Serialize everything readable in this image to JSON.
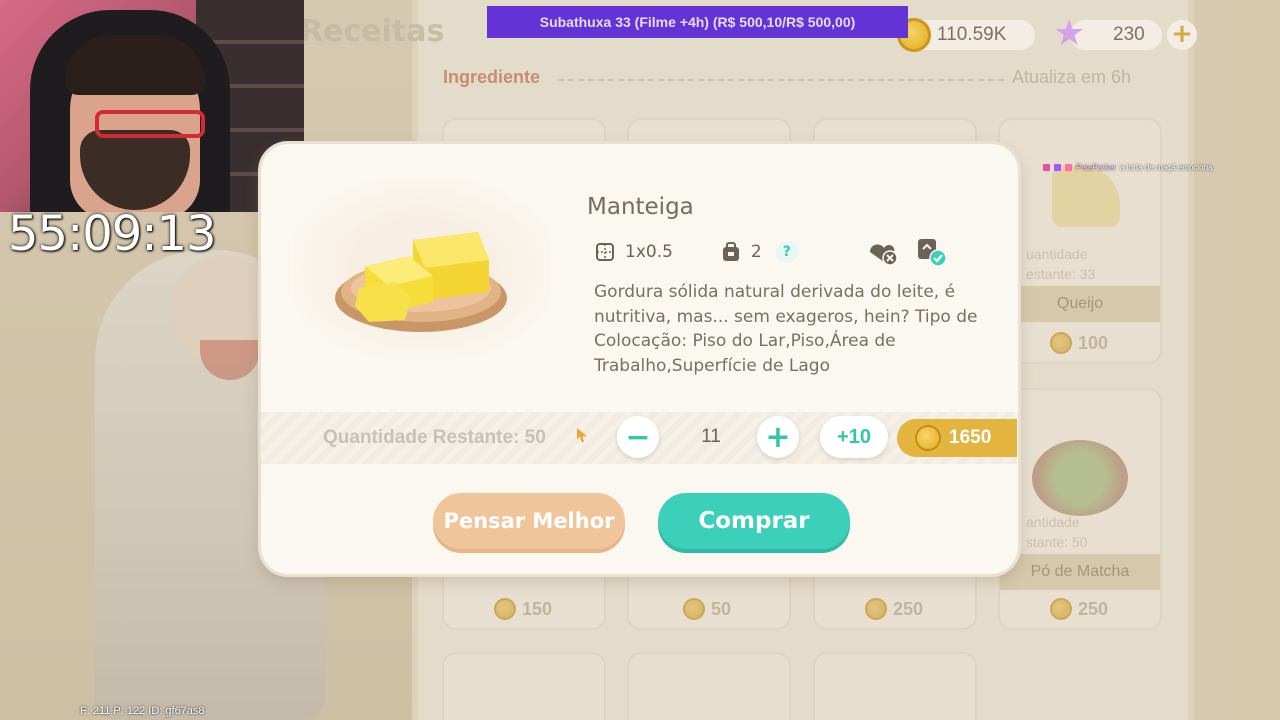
{
  "background": {
    "page_title": "Receitas",
    "section_title": "Ingrediente",
    "refresh_text": "Atualiza em 6h",
    "cards_row1": [
      {
        "name": "",
        "price": ""
      },
      {
        "name": "",
        "price": ""
      },
      {
        "name": "",
        "price": ""
      },
      {
        "name": "Queijo",
        "qty_line1": "uantidade",
        "qty_line2": "estante: 33",
        "price": "100"
      }
    ],
    "cards_row2": [
      {
        "name": "",
        "price": "150"
      },
      {
        "name": "",
        "price": "50"
      },
      {
        "name": "",
        "price": "250"
      },
      {
        "name": "Pó de Matcha",
        "qty_line1": "antidade",
        "qty_line2": "stante: 50",
        "price": "250"
      }
    ]
  },
  "currency": {
    "coins": "110.59K",
    "stars": "230",
    "plus": "+"
  },
  "donation_banner": "Subathuxa 33 (Filme +4h) (R$ 500,10/R$ 500,00)",
  "stream": {
    "timer": "55:09:13",
    "stats": "F: 211    P: 122    ID: gf67as8",
    "chat_user": "PeteParker",
    "chat_message": "a torta de maçã emociona"
  },
  "modal": {
    "item_name": "Manteiga",
    "size": "1x0.5",
    "count": "2",
    "help": "?",
    "description": "Gordura sólida natural derivada do leite, é nutritiva, mas... sem exageros, hein? Tipo de Colocação: Piso do Lar,Piso,Área de Trabalho,Superfície de Lago",
    "qty_label": "Quantidade Restante: 50",
    "quantity": "11",
    "minus": "−",
    "plus": "+",
    "plus10": "+10",
    "price": "1650",
    "cancel_label": "Pensar Melhor",
    "buy_label": "Comprar"
  },
  "colors": {
    "accent_teal": "#3ccfb9",
    "accent_orange": "#f1c59b",
    "coin_gold": "#e3b53e",
    "banner_purple": "#6433d6"
  }
}
